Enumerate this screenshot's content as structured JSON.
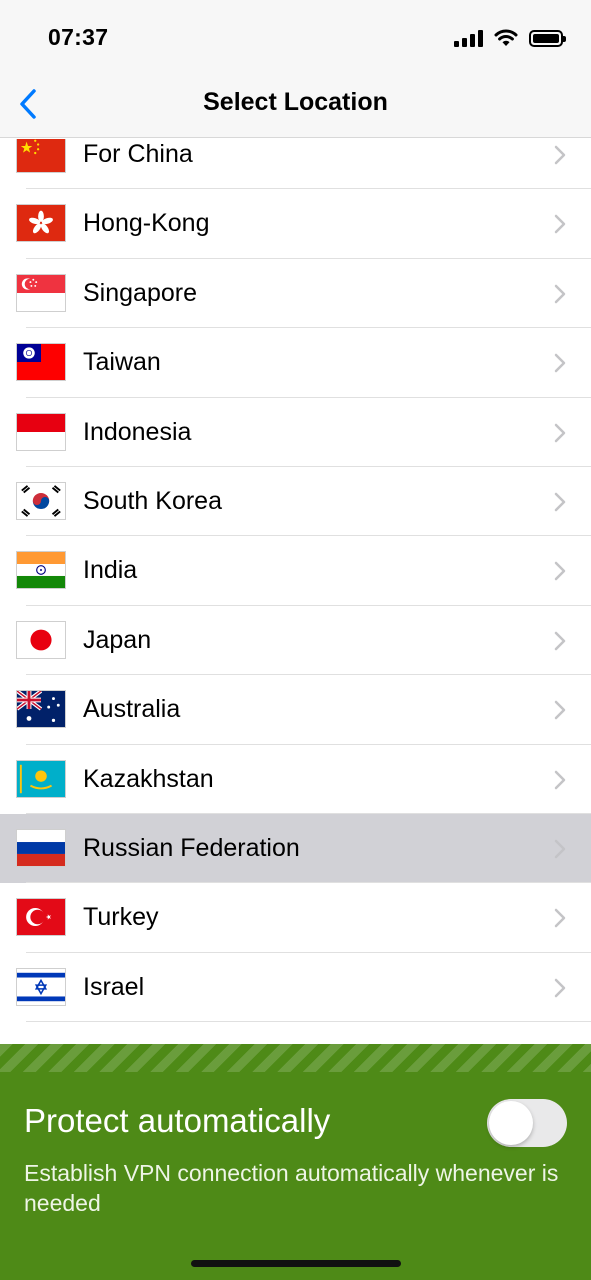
{
  "status_bar": {
    "time": "07:37"
  },
  "nav": {
    "title": "Select Location",
    "back_icon": "chevron-left-icon",
    "accent": "#007aff"
  },
  "locations": [
    {
      "label": "For China",
      "flag": "cn-flag-icon"
    },
    {
      "label": "Hong-Kong",
      "flag": "hk-flag-icon"
    },
    {
      "label": "Singapore",
      "flag": "sg-flag-icon"
    },
    {
      "label": "Taiwan",
      "flag": "tw-flag-icon"
    },
    {
      "label": "Indonesia",
      "flag": "id-flag-icon"
    },
    {
      "label": "South Korea",
      "flag": "kr-flag-icon"
    },
    {
      "label": "India",
      "flag": "in-flag-icon"
    },
    {
      "label": "Japan",
      "flag": "jp-flag-icon"
    },
    {
      "label": "Australia",
      "flag": "au-flag-icon"
    },
    {
      "label": "Kazakhstan",
      "flag": "kz-flag-icon"
    },
    {
      "label": "Russian Federation",
      "flag": "ru-flag-icon",
      "selected": true
    },
    {
      "label": "Turkey",
      "flag": "tr-flag-icon"
    },
    {
      "label": "Israel",
      "flag": "il-flag-icon"
    }
  ],
  "protect_panel": {
    "title": "Protect automatically",
    "description": "Establish VPN connection automatically whenever is needed",
    "toggle_on": false,
    "background": "#4e8a17"
  }
}
